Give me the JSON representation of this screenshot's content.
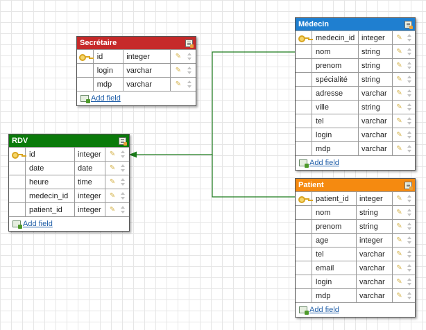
{
  "colors": {
    "red": "#c62a2a",
    "blue": "#1f7fd0",
    "green": "#0a7a0a",
    "orange": "#f58a10",
    "connector": "#1a7a1a"
  },
  "add_field_label": "Add field",
  "tables": {
    "secretaire": {
      "title": "Secrétaire",
      "fields": [
        {
          "name": "id",
          "type": "integer",
          "key": true
        },
        {
          "name": "login",
          "type": "varchar",
          "key": false
        },
        {
          "name": "mdp",
          "type": "varchar",
          "key": false
        }
      ]
    },
    "medecin": {
      "title": "Médecin",
      "fields": [
        {
          "name": "medecin_id",
          "type": "integer",
          "key": true
        },
        {
          "name": "nom",
          "type": "string",
          "key": false
        },
        {
          "name": "prenom",
          "type": "string",
          "key": false
        },
        {
          "name": "spécialité",
          "type": "string",
          "key": false
        },
        {
          "name": "adresse",
          "type": "varchar",
          "key": false
        },
        {
          "name": "ville",
          "type": "string",
          "key": false
        },
        {
          "name": "tel",
          "type": "varchar",
          "key": false
        },
        {
          "name": "login",
          "type": "varchar",
          "key": false
        },
        {
          "name": "mdp",
          "type": "varchar",
          "key": false
        }
      ]
    },
    "rdv": {
      "title": "RDV",
      "fields": [
        {
          "name": "id",
          "type": "integer",
          "key": true
        },
        {
          "name": "date",
          "type": "date",
          "key": false
        },
        {
          "name": "heure",
          "type": "time",
          "key": false
        },
        {
          "name": "medecin_id",
          "type": "integer",
          "key": false
        },
        {
          "name": "patient_id",
          "type": "integer",
          "key": false
        }
      ]
    },
    "patient": {
      "title": "Patient",
      "fields": [
        {
          "name": "patient_id",
          "type": "integer",
          "key": true
        },
        {
          "name": "nom",
          "type": "string",
          "key": false
        },
        {
          "name": "prenom",
          "type": "string",
          "key": false
        },
        {
          "name": "age",
          "type": "integer",
          "key": false
        },
        {
          "name": "tel",
          "type": "varchar",
          "key": false
        },
        {
          "name": "email",
          "type": "varchar",
          "key": false
        },
        {
          "name": "login",
          "type": "varchar",
          "key": false
        },
        {
          "name": "mdp",
          "type": "varchar",
          "key": false
        }
      ]
    }
  }
}
